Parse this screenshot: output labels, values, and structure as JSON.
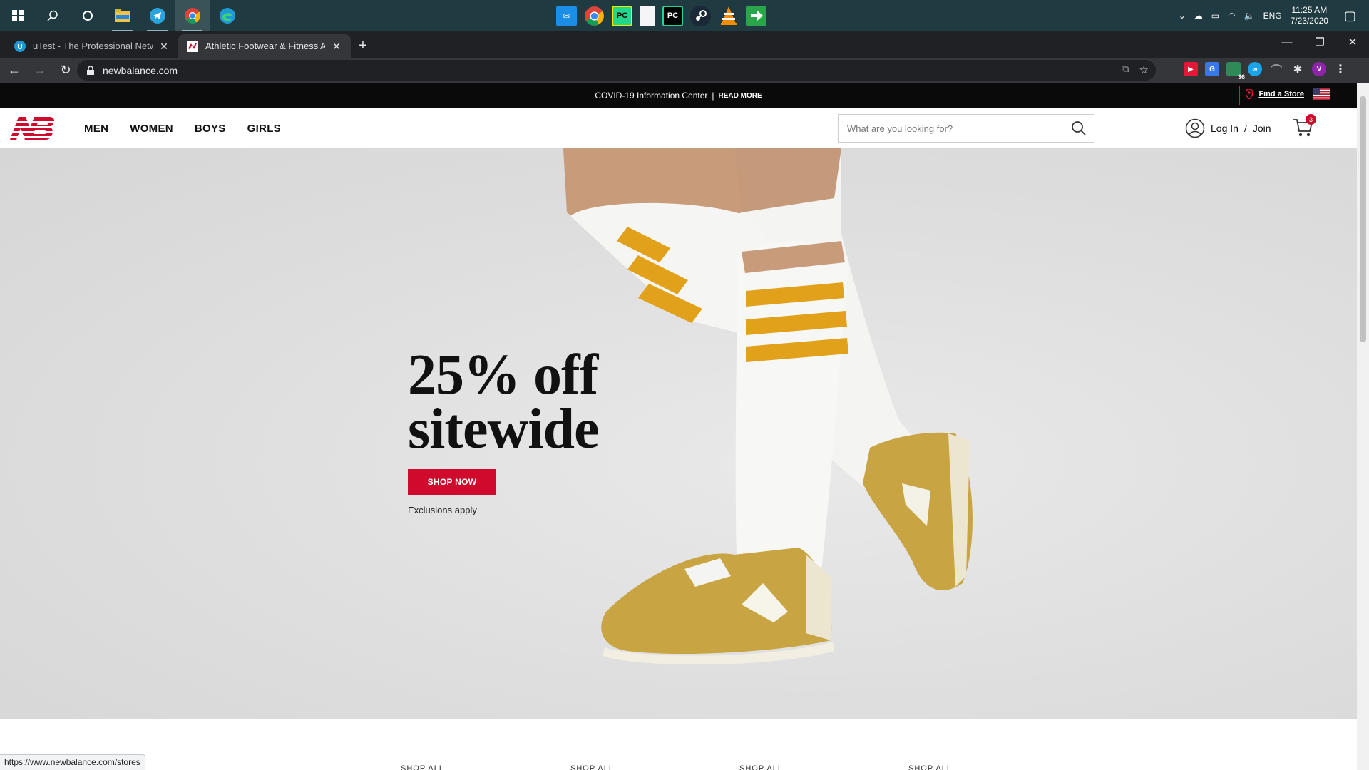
{
  "taskbar": {
    "clock_time": "11:25 AM",
    "clock_date": "7/23/2020",
    "language": "ENG",
    "pinned_apps": [
      "mail",
      "chrome",
      "pycharm-edu",
      "notepad",
      "pycharm",
      "steam",
      "vlc",
      "exit-app"
    ]
  },
  "browser": {
    "tabs": [
      {
        "title": "uTest - The Professional Network",
        "active": false
      },
      {
        "title": "Athletic Footwear & Fitness Apparel",
        "active": true
      }
    ],
    "url": "newbalance.com",
    "status_url": "https://www.newbalance.com/stores",
    "extension_badge": "36",
    "profile_initial": "V"
  },
  "site": {
    "covid_text": "COVID-19 Information Center",
    "separator": "|",
    "read_more": "READ MORE",
    "find_store": "Find a Store",
    "nav": [
      "MEN",
      "WOMEN",
      "BOYS",
      "GIRLS"
    ],
    "search_placeholder": "What are you looking for?",
    "login": "Log In",
    "login_sep": "/",
    "join": "Join",
    "cart_count": "3",
    "hero": {
      "headline_line1": "25% off",
      "headline_line2": "sitewide",
      "cta": "SHOP NOW",
      "note": "Exclusions apply"
    },
    "shop_all": [
      "SHOP ALL",
      "SHOP ALL",
      "SHOP ALL",
      "SHOP ALL"
    ]
  },
  "colors": {
    "brand_red": "#cf0a2c",
    "taskbar": "#1f3a40",
    "chrome_dark": "#202124",
    "gold": "#c9a443",
    "stripe": "#e2a11a"
  }
}
